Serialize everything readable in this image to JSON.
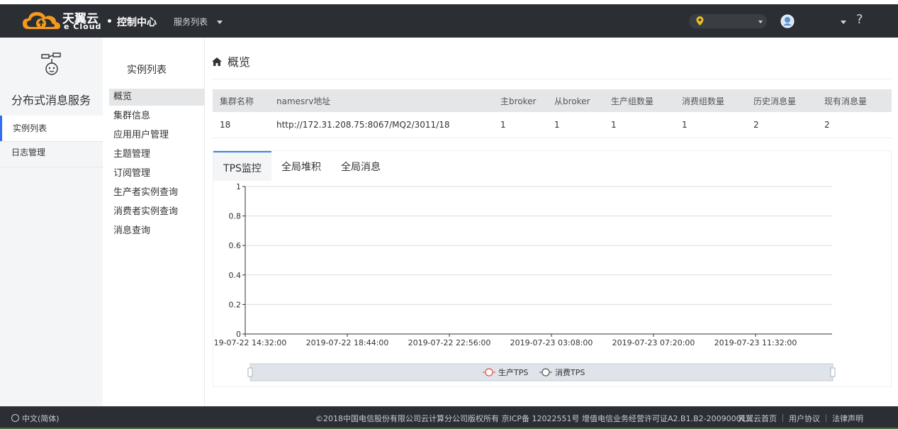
{
  "topbar": {
    "brand_cn": "天翼云",
    "brand_en": "e Cloud",
    "console_label": "控制中心",
    "services_label": "服务列表",
    "help_label": "?"
  },
  "leftnav": {
    "service_title": "分布式消息服务",
    "items": [
      {
        "label": "实例列表"
      },
      {
        "label": "日志管理"
      }
    ]
  },
  "subnav": {
    "title": "实例列表",
    "items": [
      {
        "label": "概览"
      },
      {
        "label": "集群信息"
      },
      {
        "label": "应用用户管理"
      },
      {
        "label": "主题管理"
      },
      {
        "label": "订阅管理"
      },
      {
        "label": "生产者实例查询"
      },
      {
        "label": "消费者实例查询"
      },
      {
        "label": "消息查询"
      }
    ]
  },
  "main": {
    "breadcrumb": "概览",
    "table": {
      "columns": [
        "集群名称",
        "namesrv地址",
        "主broker",
        "从broker",
        "生产组数量",
        "消费组数量",
        "历史消息量",
        "现有消息量"
      ],
      "rows": [
        [
          "18",
          "http://172.31.208.75:8067/MQ2/3011/18",
          "1",
          "1",
          "1",
          "1",
          "2",
          "2"
        ]
      ]
    },
    "tabs": [
      {
        "label": "TPS监控"
      },
      {
        "label": "全局堆积"
      },
      {
        "label": "全局消息"
      }
    ]
  },
  "chart_data": {
    "type": "line",
    "x_ticks": [
      "2019-07-22 14:32:00",
      "2019-07-22 18:44:00",
      "2019-07-22 22:56:00",
      "2019-07-23 03:08:00",
      "2019-07-23 07:20:00",
      "2019-07-23 11:32:00"
    ],
    "y_ticks": [
      "0",
      "0.2",
      "0.4",
      "0.6",
      "0.8",
      "1"
    ],
    "ylim": [
      0,
      1
    ],
    "grid": true,
    "legend_placement": "bottom",
    "series": [
      {
        "name": "生产TPS",
        "values": [],
        "color": "#e04b4b"
      },
      {
        "name": "消费TPS",
        "values": [],
        "color": "#555555"
      }
    ]
  },
  "footer": {
    "language": "中文(简体)",
    "copyright": "©2018中国电信股份有限公司云计算分公司版权所有 京ICP备 12022551号 增值电信业务经营许可证A2.B1.B2-20090001",
    "links": [
      "天翼云首页",
      "用户协议",
      "法律声明"
    ]
  },
  "colors": {
    "topbar_bg": "#2b2e33",
    "accent": "#2f6ef5",
    "region_pin": "#f3c11b"
  },
  "icons": {
    "logo": "tianyi-cloud-logo",
    "home": "home-icon",
    "region": "location-pin-icon",
    "avatar": "user-avatar-icon",
    "service": "robot-service-icon",
    "language": "globe-icon"
  }
}
